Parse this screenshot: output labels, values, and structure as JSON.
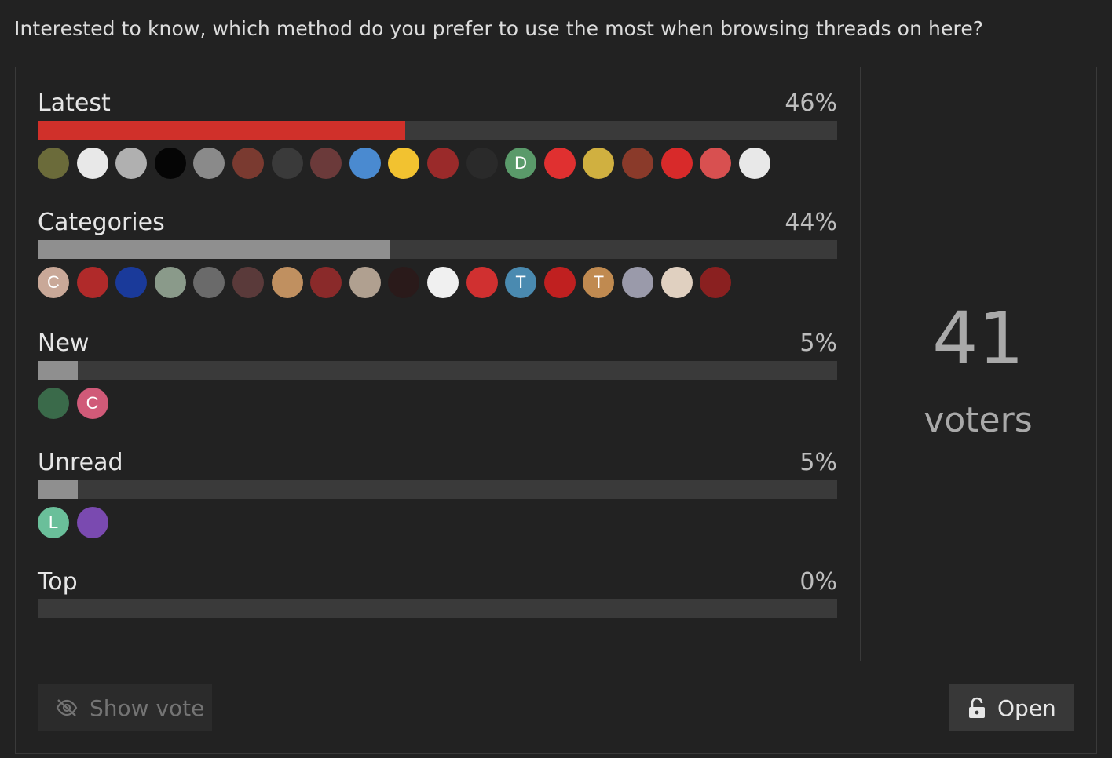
{
  "question": "Interested to know, which method do you prefer to use the most when browsing threads on here?",
  "accent": "#d0302a",
  "options": [
    {
      "label": "Latest",
      "percent": "46%",
      "value": 46,
      "winner": true,
      "avatars": [
        {
          "letter": "",
          "color": "#6b6b3a"
        },
        {
          "letter": "",
          "color": "#e8e8e8"
        },
        {
          "letter": "",
          "color": "#b0b0b0"
        },
        {
          "letter": "",
          "color": "#050505"
        },
        {
          "letter": "",
          "color": "#8a8a8a"
        },
        {
          "letter": "",
          "color": "#7a3a30"
        },
        {
          "letter": "",
          "color": "#3a3a3a"
        },
        {
          "letter": "",
          "color": "#6b3a3a"
        },
        {
          "letter": "",
          "color": "#4a8ad0"
        },
        {
          "letter": "",
          "color": "#f2c230"
        },
        {
          "letter": "",
          "color": "#9a2a2a"
        },
        {
          "letter": "",
          "color": "#2a2a2a"
        },
        {
          "letter": "D",
          "color": "#5a9a6a"
        },
        {
          "letter": "",
          "color": "#e03030"
        },
        {
          "letter": "",
          "color": "#d0b040"
        },
        {
          "letter": "",
          "color": "#8a3a2a"
        },
        {
          "letter": "",
          "color": "#d82a2a"
        },
        {
          "letter": "",
          "color": "#d85050"
        },
        {
          "letter": "",
          "color": "#e8e8e8"
        }
      ]
    },
    {
      "label": "Categories",
      "percent": "44%",
      "value": 44,
      "winner": false,
      "avatars": [
        {
          "letter": "C",
          "color": "#c9a898"
        },
        {
          "letter": "",
          "color": "#b02a2a"
        },
        {
          "letter": "",
          "color": "#1a3a9a"
        },
        {
          "letter": "",
          "color": "#8a9a8a"
        },
        {
          "letter": "",
          "color": "#6a6a6a"
        },
        {
          "letter": "",
          "color": "#5a3a3a"
        },
        {
          "letter": "",
          "color": "#c09060"
        },
        {
          "letter": "",
          "color": "#8a2a2a"
        },
        {
          "letter": "",
          "color": "#b0a090"
        },
        {
          "letter": "",
          "color": "#2a1a1a"
        },
        {
          "letter": "",
          "color": "#f0f0f0"
        },
        {
          "letter": "",
          "color": "#d03030"
        },
        {
          "letter": "T",
          "color": "#4a8ab0"
        },
        {
          "letter": "",
          "color": "#c02020"
        },
        {
          "letter": "T",
          "color": "#c08a50"
        },
        {
          "letter": "",
          "color": "#9a9aaa"
        },
        {
          "letter": "",
          "color": "#e0d0c0"
        },
        {
          "letter": "",
          "color": "#8a2020"
        }
      ]
    },
    {
      "label": "New",
      "percent": "5%",
      "value": 5,
      "winner": false,
      "avatars": [
        {
          "letter": "",
          "color": "#3a6a4a"
        },
        {
          "letter": "C",
          "color": "#d05a78"
        }
      ]
    },
    {
      "label": "Unread",
      "percent": "5%",
      "value": 5,
      "winner": false,
      "avatars": [
        {
          "letter": "L",
          "color": "#6abf9a"
        },
        {
          "letter": "",
          "color": "#7a4ab0"
        }
      ]
    },
    {
      "label": "Top",
      "percent": "0%",
      "value": 0,
      "winner": false,
      "avatars": []
    }
  ],
  "voters": {
    "count": "41",
    "label": "voters"
  },
  "buttons": {
    "show_vote": "Show vote",
    "show_vote_icon": "eye-slash-icon",
    "open": "Open",
    "open_icon": "unlock-icon"
  }
}
